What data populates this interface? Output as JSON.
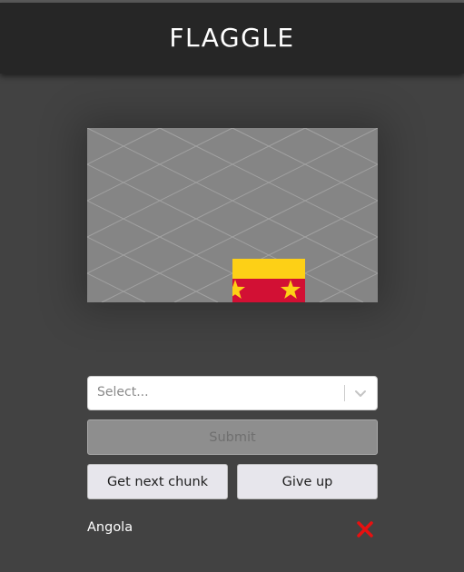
{
  "app": {
    "title": "FLAGGLE"
  },
  "select": {
    "placeholder": "Select..."
  },
  "buttons": {
    "submit": "Submit",
    "next_chunk": "Get next chunk",
    "give_up": "Give up"
  },
  "guesses": [
    {
      "country": "Angola",
      "correct": false
    }
  ],
  "colors": {
    "background": "#424242",
    "header": "#262626",
    "board": "#858585",
    "flag_yellow": "#fdd016",
    "flag_red": "#d21034",
    "wrong_mark": "#e81010"
  },
  "icons": {
    "dropdown": "chevron-down-icon",
    "wrong": "close-icon",
    "flag_star": "star-icon"
  }
}
